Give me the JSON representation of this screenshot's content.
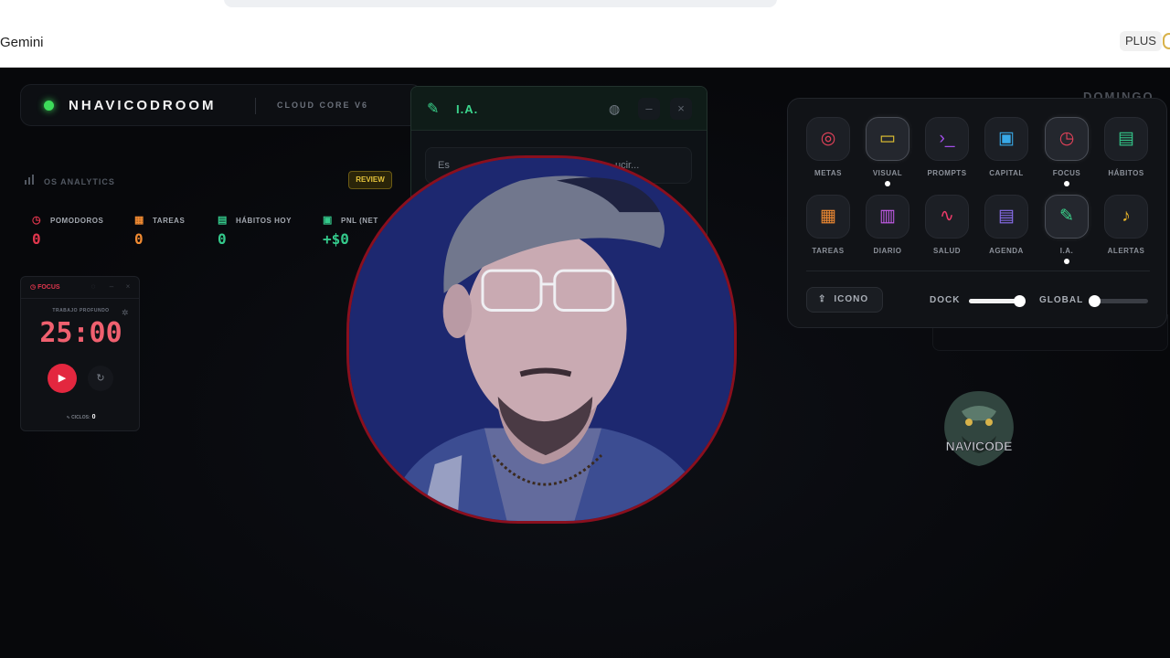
{
  "browser": {
    "title": "Gemini",
    "plan_badge": "PLUS"
  },
  "header": {
    "brand": "NHAVICODROOM",
    "subtitle": "CLOUD CORE V6",
    "day": "DOMINGO"
  },
  "analytics": {
    "label": "OS ANALYTICS",
    "review_label": "REVIEW",
    "stats": [
      {
        "label": "POMODOROS",
        "value": "0",
        "icon": "clock-icon",
        "color": "#e0364d"
      },
      {
        "label": "TAREAS",
        "value": "0",
        "icon": "grid-icon",
        "color": "#f08a32"
      },
      {
        "label": "HÁBITOS HOY",
        "value": "0",
        "icon": "calendar-icon",
        "color": "#34c98b"
      },
      {
        "label": "PNL (NET",
        "value": "+$0",
        "icon": "wallet-icon",
        "color": "#34c98b"
      }
    ]
  },
  "focus_widget": {
    "title": "FOCUS",
    "mode": "TRABAJO PROFUNDO",
    "time": "25:00",
    "cycles_label": "CICLOS:",
    "cycles_value": "0"
  },
  "ia_panel": {
    "title": "I.A.",
    "placeholder_start": "Es",
    "placeholder_end": "ucir..."
  },
  "dock": {
    "apps": [
      {
        "label": "METAS",
        "icon": "target-icon",
        "color": "#e5425a",
        "active": false,
        "dot": false
      },
      {
        "label": "VISUAL",
        "icon": "presentation-icon",
        "color": "#e6c531",
        "active": true,
        "dot": true
      },
      {
        "label": "PROMPTS",
        "icon": "terminal-icon",
        "color": "#a24fe8",
        "active": false,
        "dot": false
      },
      {
        "label": "CAPITAL",
        "icon": "wallet-icon",
        "color": "#38a9e8",
        "active": false,
        "dot": false
      },
      {
        "label": "FOCUS",
        "icon": "clock-icon",
        "color": "#e5425a",
        "active": true,
        "dot": true
      },
      {
        "label": "HÁBITOS",
        "icon": "calendar-icon",
        "color": "#34c98b",
        "active": false,
        "dot": false
      },
      {
        "label": "TAREAS",
        "icon": "grid-icon",
        "color": "#f08a32",
        "active": false,
        "dot": false
      },
      {
        "label": "DIARIO",
        "icon": "book-icon",
        "color": "#c35ce8",
        "active": false,
        "dot": false
      },
      {
        "label": "SALUD",
        "icon": "pulse-icon",
        "color": "#ee3a6a",
        "active": false,
        "dot": false
      },
      {
        "label": "AGENDA",
        "icon": "calendar-icon",
        "color": "#8b6ff0",
        "active": false,
        "dot": false
      },
      {
        "label": "I.A.",
        "icon": "pen-icon",
        "color": "#3bd68d",
        "active": true,
        "dot": true
      },
      {
        "label": "ALERTAS",
        "icon": "bell-icon",
        "color": "#e8b428",
        "active": false,
        "dot": false
      }
    ],
    "icono_label": "ICONO",
    "dock_label": "DOCK",
    "dock_slider": 0.88,
    "global_label": "GLOBAL",
    "global_slider": 0.02
  },
  "logo_text": "NAVICODE"
}
